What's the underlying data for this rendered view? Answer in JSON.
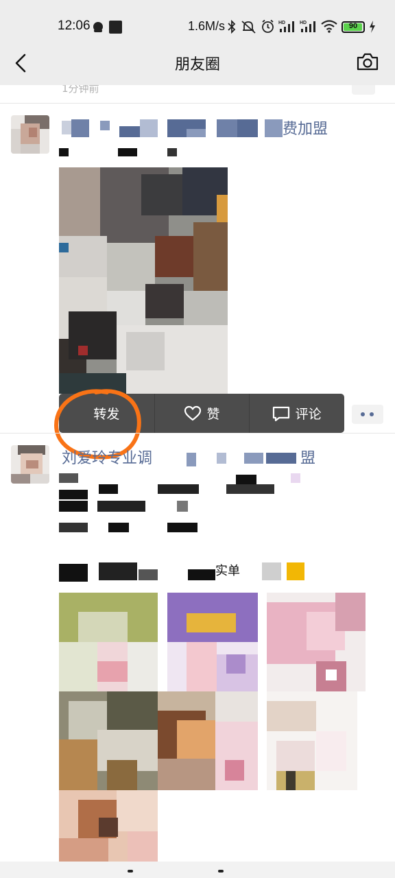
{
  "status_bar": {
    "time": "12:06",
    "net_speed": "1.6M/s",
    "battery": "90",
    "icons": [
      "qq-icon",
      "notification-icon",
      "bluetooth-icon",
      "mute-icon",
      "alarm-icon",
      "signal-hd-icon",
      "signal-hd-icon",
      "wifi-icon",
      "battery-icon",
      "charging-icon"
    ]
  },
  "nav": {
    "title": "朋友圈",
    "back_icon": "back-arrow-icon",
    "camera_icon": "camera-icon"
  },
  "previous_post": {
    "time": "1分钟前"
  },
  "post1": {
    "author_suffix": "费加盟",
    "actions": {
      "forward": "转发",
      "like": "赞",
      "comment": "评论"
    }
  },
  "post2": {
    "author_prefix": "刘爱玲专业调",
    "author_suffix": "盟",
    "text_fragment": "实单"
  },
  "colors": {
    "link": "#576b95",
    "annotation": "#f97316",
    "popup": "#4c4c4c"
  }
}
